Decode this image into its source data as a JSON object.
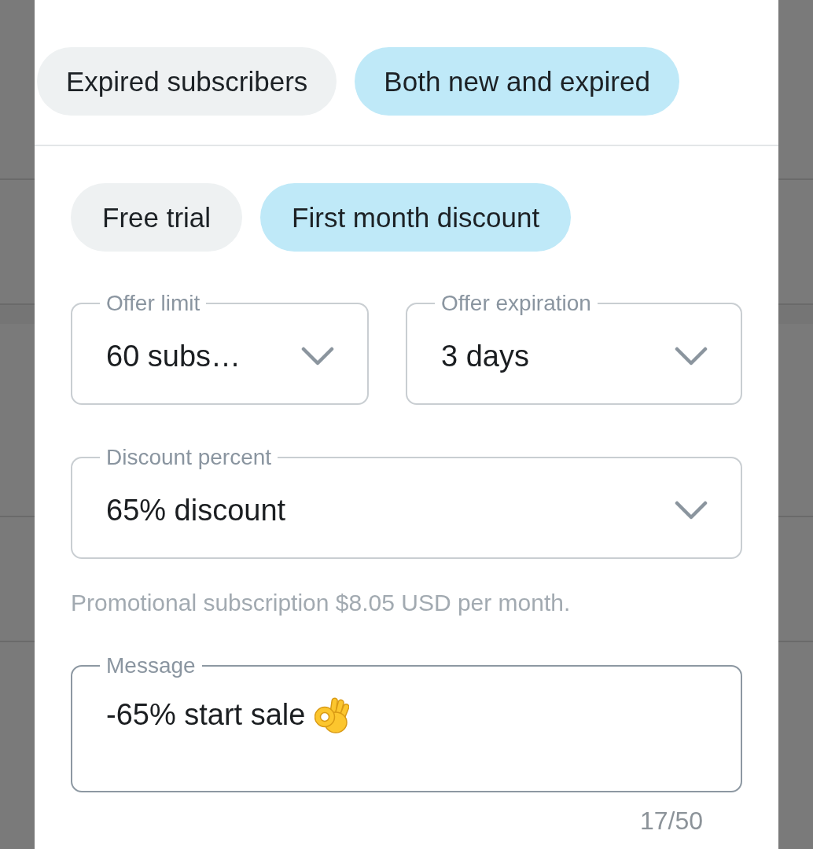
{
  "audience_chips": [
    {
      "label": "Expired subscribers",
      "selected": false
    },
    {
      "label": "Both new and expired",
      "selected": true
    }
  ],
  "offer_type_chips": [
    {
      "label": "Free trial",
      "selected": false
    },
    {
      "label": "First month discount",
      "selected": true
    }
  ],
  "offer_limit": {
    "label": "Offer limit",
    "value": "60 subs…"
  },
  "offer_expiration": {
    "label": "Offer expiration",
    "value": "3 days"
  },
  "discount_percent": {
    "label": "Discount percent",
    "value": "65% discount"
  },
  "price_note": "Promotional subscription $8.05 USD per month.",
  "message": {
    "label": "Message",
    "value": "-65% start sale",
    "focused": true,
    "counter": "17/50"
  }
}
